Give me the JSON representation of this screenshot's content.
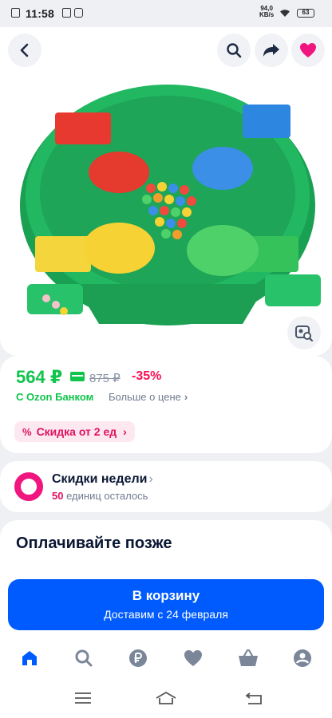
{
  "status_bar": {
    "time": "11:58",
    "net_speed_value": "94,0",
    "net_speed_unit": "KB/s",
    "battery": "63"
  },
  "header": {
    "back_icon": "chevron-left-icon",
    "search_icon": "search-icon",
    "share_icon": "share-arrow-icon",
    "favorite_icon": "heart-icon"
  },
  "product": {
    "price": "564 ₽",
    "old_price": "875 ₽",
    "discount": "-35%",
    "bank_label": "С Ozon Банком",
    "more_price_label": "Больше о цене",
    "bulk_discount_label": "Скидка от 2 ед"
  },
  "weekly_deals": {
    "title": "Скидки недели",
    "units_count": "50",
    "units_text": "единиц осталось"
  },
  "pay_later": {
    "title": "Оплачивайте позже"
  },
  "cart_button": {
    "label": "В корзину",
    "delivery": "Доставим с 24 февраля"
  },
  "colors": {
    "accent": "#005bff",
    "price_green": "#10c44c",
    "discount_pink": "#f91155",
    "favorite_pink": "#f0157f"
  },
  "tab_bar": [
    "home-icon",
    "search-icon",
    "ruble-icon",
    "heart-icon",
    "basket-icon",
    "profile-icon"
  ]
}
